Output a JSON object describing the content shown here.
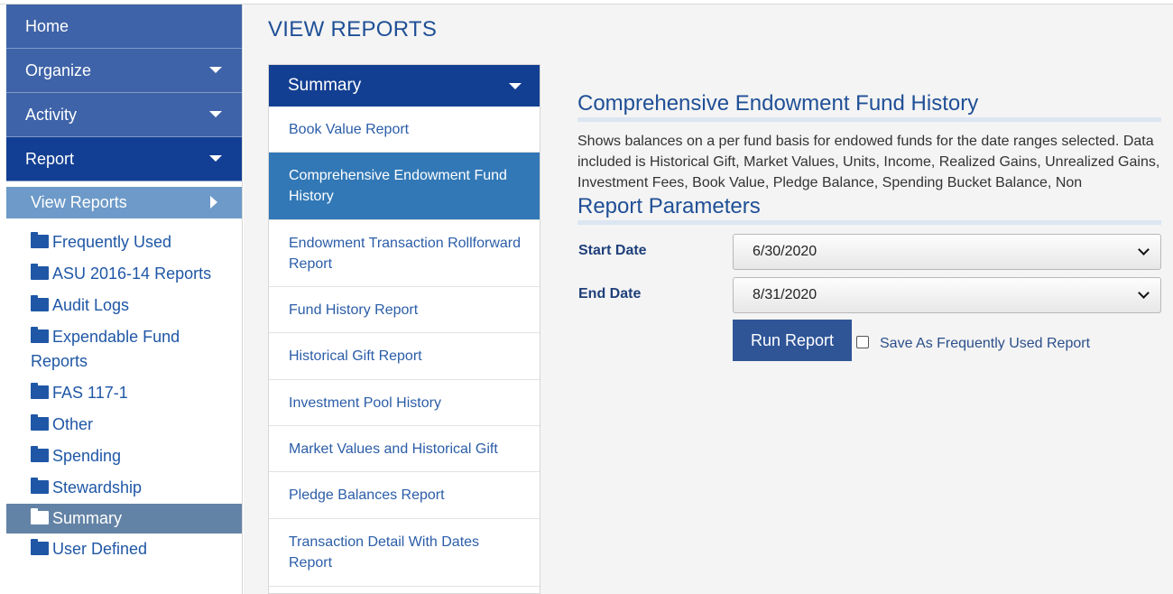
{
  "sidebar": {
    "nav": [
      {
        "label": "Home",
        "has_caret": false
      },
      {
        "label": "Organize",
        "has_caret": true
      },
      {
        "label": "Activity",
        "has_caret": true
      },
      {
        "label": "Report",
        "has_caret": true,
        "active": true
      }
    ],
    "subnav_label": "View Reports",
    "folders": [
      {
        "label": "Frequently Used"
      },
      {
        "label": "ASU 2016-14 Reports"
      },
      {
        "label": "Audit Logs"
      },
      {
        "label": "Expendable Fund Reports"
      },
      {
        "label": "FAS 117-1"
      },
      {
        "label": "Other"
      },
      {
        "label": "Spending"
      },
      {
        "label": "Stewardship"
      },
      {
        "label": "Summary",
        "selected": true
      },
      {
        "label": "User Defined"
      }
    ]
  },
  "page_title": "VIEW REPORTS",
  "report_list": {
    "header": "Summary",
    "items": [
      {
        "label": "Book Value Report"
      },
      {
        "label": "Comprehensive Endowment Fund History",
        "selected": true
      },
      {
        "label": "Endowment Transaction Rollforward Report"
      },
      {
        "label": "Fund History Report"
      },
      {
        "label": "Historical Gift Report"
      },
      {
        "label": "Investment Pool History"
      },
      {
        "label": "Market Values and Historical Gift"
      },
      {
        "label": "Pledge Balances Report"
      },
      {
        "label": "Transaction Detail With Dates Report"
      }
    ]
  },
  "report": {
    "title": "Comprehensive Endowment Fund History",
    "description": "Shows balances on a per fund basis for endowed funds for the date ranges selected. Data included is Historical Gift, Market Values, Units, Income, Realized Gains, Unrealized Gains, Investment Fees, Book Value, Pledge Balance, Spending Bucket Balance, Non",
    "params_title": "Report Parameters",
    "start_label": "Start Date",
    "start_value": "6/30/2020",
    "end_label": "End Date",
    "end_value": "8/31/2020",
    "run_label": "Run Report",
    "save_label": "Save As Frequently Used Report"
  },
  "colors": {
    "nav_bg": "#3e63a8",
    "nav_active": "#123f93",
    "subnav_bg": "#6d9ac8",
    "folder_selected": "#6383a6",
    "list_selected": "#3278b6",
    "button": "#2f5597",
    "link": "#2b5da8"
  }
}
